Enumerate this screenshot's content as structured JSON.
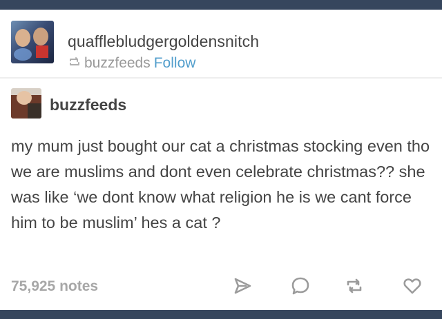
{
  "header": {
    "username": "quafflebludgergoldensnitch",
    "reblogged_from": "buzzfeeds",
    "follow_label": "Follow"
  },
  "trail": {
    "blog_name": "buzzfeeds",
    "body": "my mum just bought our cat a christmas stocking even tho we are muslims and dont even celebrate christmas?? she was like ‘we dont know what religion he is we cant force him to be muslim’ hes a cat ?"
  },
  "footer": {
    "notes": "75,925 notes",
    "icons": [
      "share-icon",
      "reply-icon",
      "reblog-icon",
      "like-icon"
    ]
  },
  "colors": {
    "background": "#36465d",
    "card": "#ffffff",
    "text": "#444444",
    "link": "#529ecc",
    "muted": "#999999"
  }
}
